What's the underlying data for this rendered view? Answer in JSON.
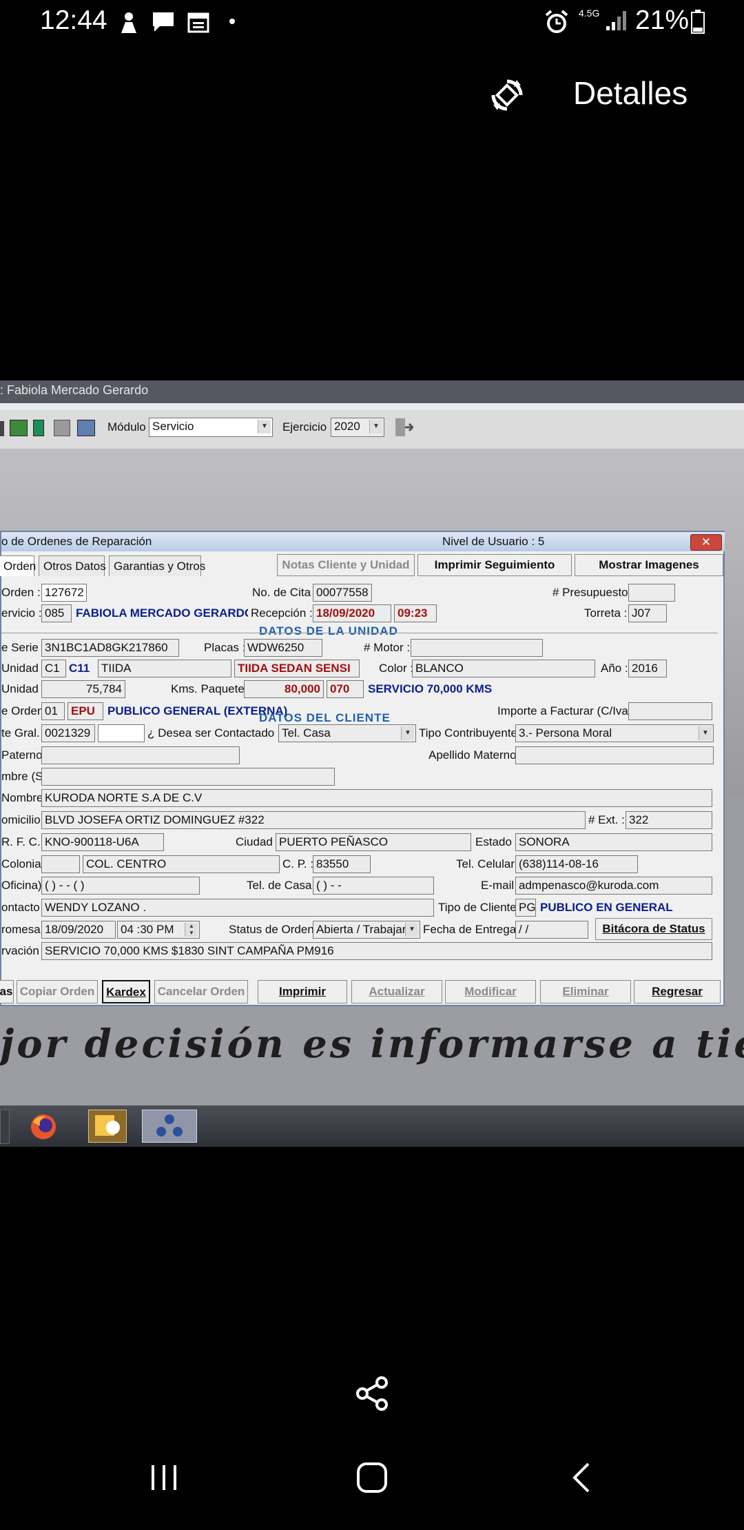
{
  "status_bar": {
    "time": "12:44",
    "network": "4.5G",
    "battery": "21%"
  },
  "gallery": {
    "details": "Detalles"
  },
  "app": {
    "title": ": Fabiola Mercado Gerardo",
    "toolbar": {
      "modulo_label": "Módulo :",
      "modulo_value": "Servicio",
      "ejercicio_label": "Ejercicio :",
      "ejercicio_value": "2020"
    }
  },
  "dialog": {
    "title": "o de Ordenes de Reparación",
    "user_level": "Nivel de Usuario : 5",
    "close": "✕",
    "tabs": [
      "Orden",
      "Otros Datos",
      "Garantias y Otros"
    ],
    "top_buttons": [
      "Notas Cliente y Unidad",
      "Imprimir Seguimiento",
      "Mostrar Imagenes"
    ],
    "sections": {
      "unidad": "DATOS DE LA UNIDAD",
      "cliente": "DATOS DEL CLIENTE"
    },
    "fields": {
      "orden_label": "Orden :",
      "orden": "127672",
      "cita_label": "No. de Cita :",
      "cita": "00077558",
      "presupuesto_label": "# Presupuesto :",
      "servicio_label": "ervicio :",
      "servicio_code": "085",
      "servicio_name": "FABIOLA MERCADO GERARDO",
      "recepcion_label": "Recepción :",
      "recepcion_date": "18/09/2020",
      "recepcion_time": "09:23",
      "torreta_label": "Torreta :",
      "torreta": "J07",
      "serie_label": "e Serie :",
      "serie": "3N1BC1AD8GK217860",
      "placas_label": "Placas :",
      "placas": "WDW6250",
      "motor_label": "# Motor :",
      "unidad_label": "Unidad :",
      "unidad_code": "C1",
      "unidad_model_code": "C11",
      "unidad_model": "TIIDA",
      "unidad_desc": "TIIDA SEDAN SENSI",
      "color_label": "Color :",
      "color": "BLANCO",
      "anio_label": "Año :",
      "anio": "2016",
      "km_label": "Unidad :",
      "km": "75,784",
      "paquete_label": "Kms. Paquete :",
      "paquete_km": "80,000",
      "paquete_code": "070",
      "paquete_desc": "SERVICIO 70,000 KMS",
      "tipo_orden_label": "e Orden :",
      "tipo_orden_code": "01",
      "tipo_orden_abbr": "EPU",
      "tipo_orden_desc": "PUBLICO GENERAL (EXTERNA)",
      "importe_label": "Importe a Facturar (C/Iva) :",
      "cte_label": "te Gral. :",
      "cte": "0021329",
      "contactado_label": "¿ Desea ser Contactado ? :",
      "contactado": "Tel. Casa",
      "contribuyente_label": "Tipo Contribuyente :",
      "contribuyente": "3.- Persona Moral",
      "paterno_label": "Paterno :",
      "materno_label": "Apellido Materno :",
      "nombres_label": "mbre (S) :",
      "nombre_label": "Nombre :",
      "nombre": "KURODA NORTE S.A  DE C.V",
      "domicilio_label": "omicilio :",
      "domicilio": "BLVD JOSEFA ORTIZ DOMINGUEZ #322",
      "ext_label": "# Ext. :",
      "ext": "322",
      "rfc_label": "R. F. C. :",
      "rfc": "KNO-900118-U6A",
      "ciudad_label": "Ciudad :",
      "ciudad": "PUERTO PEÑASCO",
      "estado_label": "Estado :",
      "estado": "SONORA",
      "colonia_label": "Colonia :",
      "colonia": "COL. CENTRO",
      "cp_label": "C. P. :",
      "cp": "83550",
      "celular_label": "Tel. Celular :",
      "celular": "(638)114-08-16",
      "oficina_label": "Oficina) :",
      "oficina": "(  )   -  -  (   )",
      "casa_label": "Tel. de Casa :",
      "casa": "(  )   -  -",
      "email_label": "E-mail :",
      "email": "admpenasco@kuroda.com",
      "contacto_label": "ontacto :",
      "contacto": "WENDY LOZANO .",
      "tipo_cliente_label": "Tipo de Cliente :",
      "tipo_cliente_code": "PG",
      "tipo_cliente": "PUBLICO EN GENERAL",
      "promesa_label": "romesa :",
      "promesa_date": "18/09/2020",
      "promesa_time": "04 :30  PM",
      "status_label": "Status de Orden :",
      "status": "Abierta / Trabajar",
      "entrega_label": "Fecha de Entrega :",
      "entrega": "  /  /",
      "bitacora": "Bitácora de Status",
      "observacion_label": "rvación :",
      "observacion": "SERVICIO 70,000 KMS  $1830  SINT CAMPAÑA PM916"
    },
    "bottom_buttons": [
      "as",
      "Copiar Orden",
      "Kardex",
      "Cancelar Orden",
      "Imprimir",
      "Actualizar",
      "Modificar",
      "Eliminar",
      "Regresar"
    ]
  },
  "slogan": "jor decisión es informarse a tien",
  "colors": {
    "accent_blue": "#0b1e8c",
    "accent_red": "#a01010",
    "section_blue": "#1f5fb0"
  }
}
